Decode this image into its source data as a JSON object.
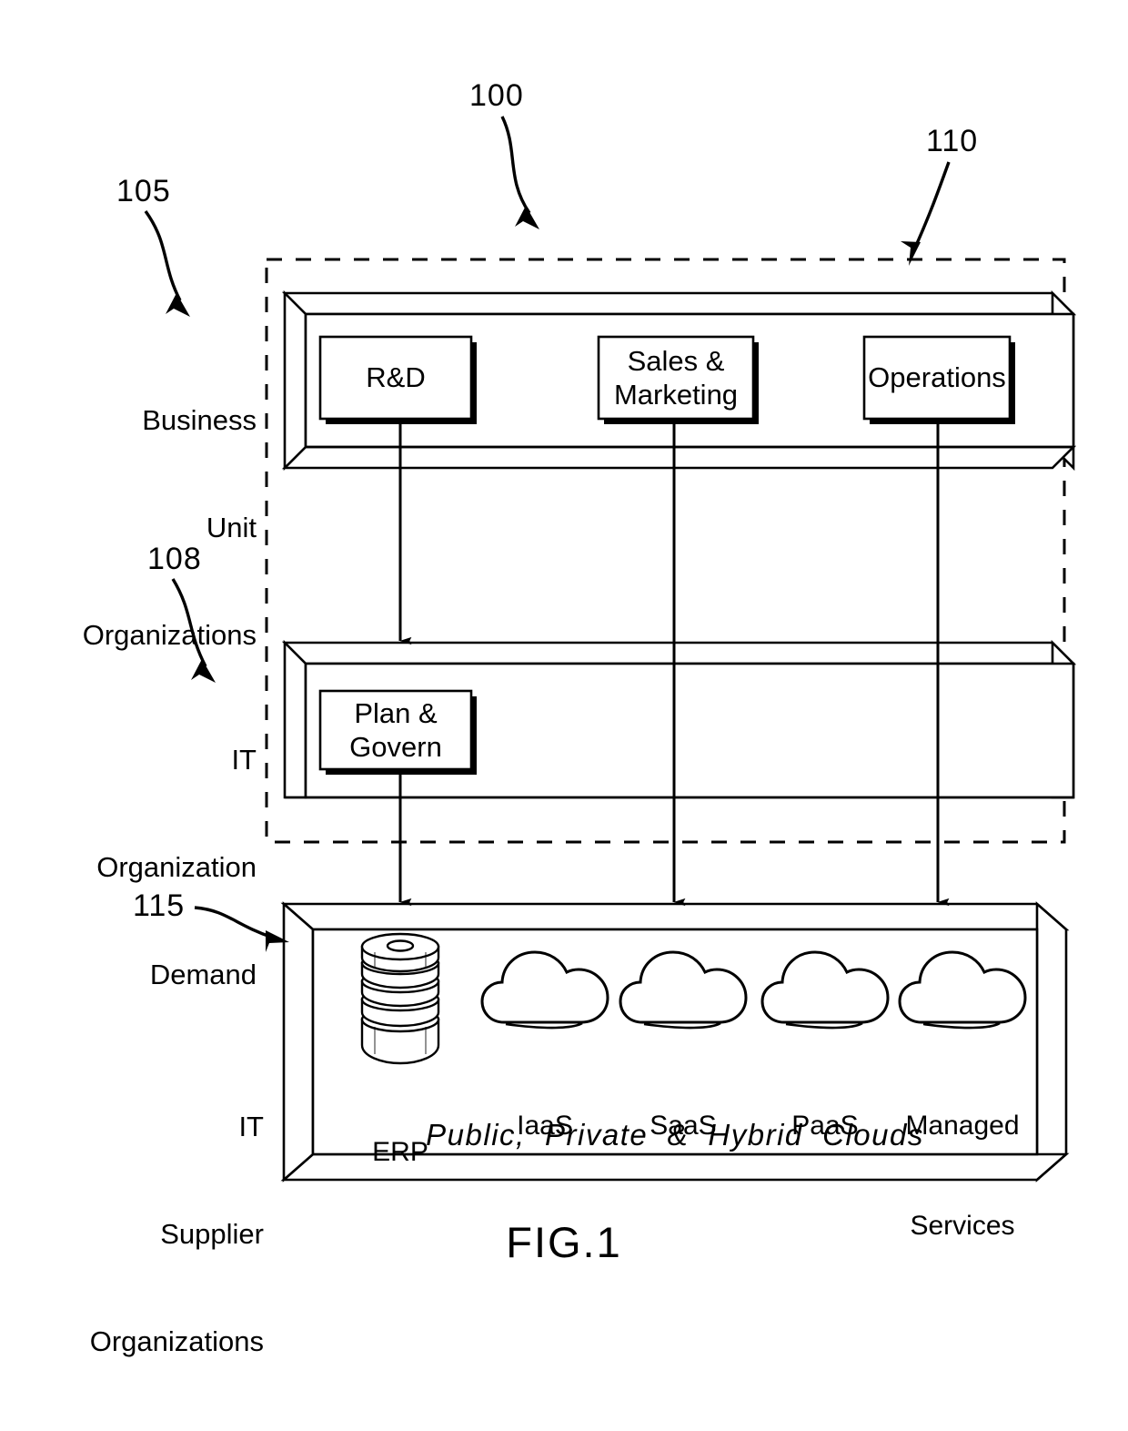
{
  "figure": {
    "title": "FIG.1",
    "caption_banner": "Public,  Private  &  Hybrid  Clouds"
  },
  "reference_numerals": {
    "system": "100",
    "business_unit": "105",
    "it_demand": "108",
    "boundary": "110",
    "it_supplier": "115"
  },
  "tiers": {
    "business_unit": {
      "label_line1": "Business",
      "label_line2": "Unit",
      "label_line3": "Organizations",
      "items": [
        {
          "label_line1": "R&D",
          "label_line2": ""
        },
        {
          "label_line1": "Sales  &",
          "label_line2": "Marketing"
        },
        {
          "label_line1": "Operations",
          "label_line2": ""
        }
      ]
    },
    "it_organization": {
      "label_line1": "IT",
      "label_line2": "Organization",
      "label_line3": "Demand",
      "items": [
        {
          "label_line1": "Plan  &",
          "label_line2": "Govern"
        }
      ]
    },
    "it_supplier": {
      "label_line1": "IT",
      "label_line2": "Supplier",
      "label_line3": "Organizations",
      "services": [
        {
          "name": "ERP",
          "icon": "database-cylinder-icon",
          "line2": ""
        },
        {
          "name": "IaaS",
          "icon": "cloud-icon",
          "line2": ""
        },
        {
          "name": "SaaS",
          "icon": "cloud-icon",
          "line2": ""
        },
        {
          "name": "PaaS",
          "icon": "cloud-icon",
          "line2": ""
        },
        {
          "name": "Managed",
          "icon": "cloud-icon",
          "line2": "Services"
        }
      ]
    }
  },
  "colors": {
    "stroke": "#000000",
    "background": "#ffffff"
  }
}
